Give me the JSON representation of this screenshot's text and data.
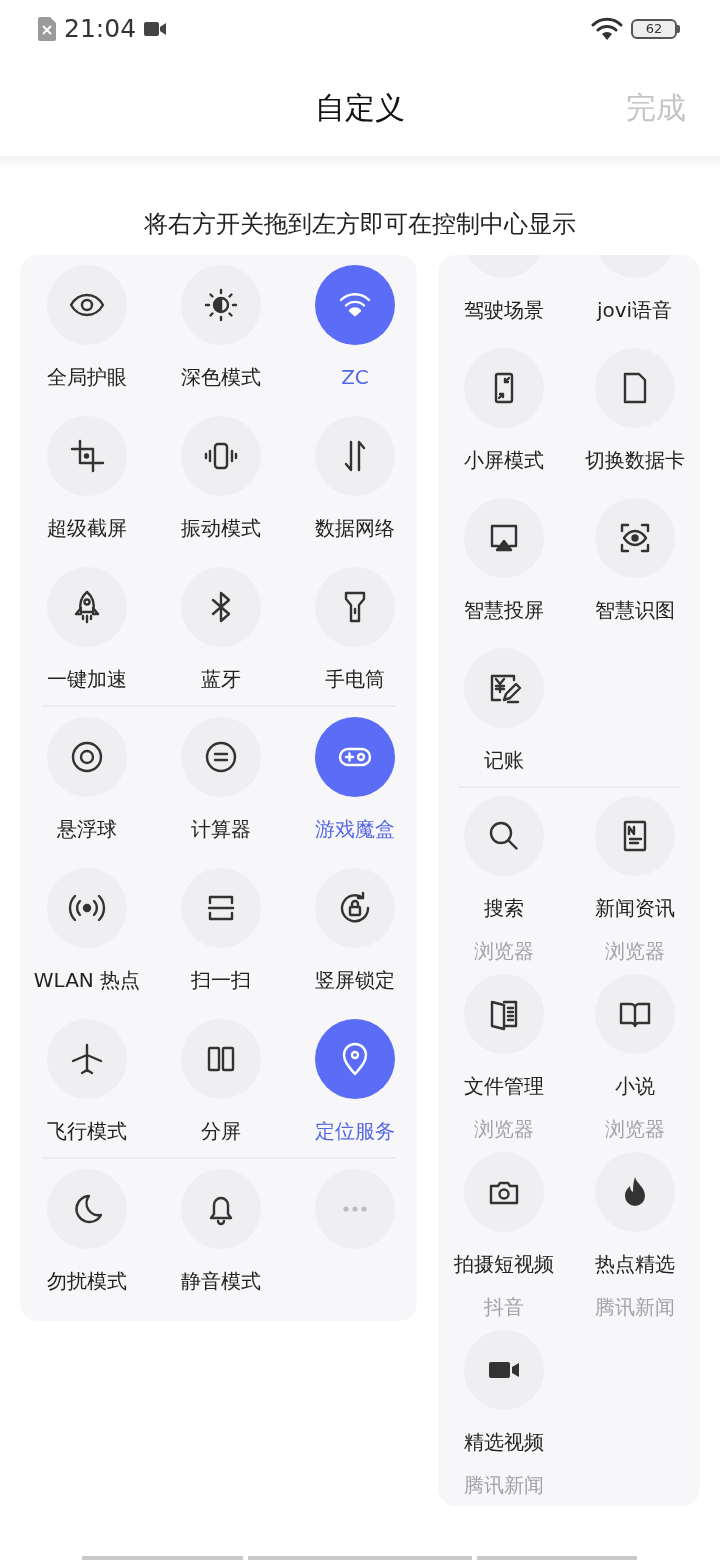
{
  "status_bar": {
    "time": "21:04",
    "battery": "62"
  },
  "header": {
    "title": "自定义",
    "done": {
      "label": "完成",
      "disabled": true
    }
  },
  "hint": "将右方开关拖到左方即可在控制中心显示",
  "active_panel": {
    "groups": [
      {
        "tiles": [
          {
            "kind": "toggle",
            "label": "全局护眼",
            "on": false
          },
          {
            "kind": "toggle",
            "label": "深色模式",
            "on": false
          },
          {
            "kind": "toggle",
            "label": "ZC",
            "on": true
          },
          {
            "kind": "toggle",
            "label": "超级截屏",
            "on": false
          },
          {
            "kind": "toggle",
            "label": "振动模式",
            "on": false
          },
          {
            "kind": "toggle",
            "label": "数据网络",
            "on": false
          },
          {
            "kind": "toggle",
            "label": "一键加速",
            "on": false
          },
          {
            "kind": "toggle",
            "label": "蓝牙",
            "on": false
          },
          {
            "kind": "toggle",
            "label": "手电筒",
            "on": false
          }
        ]
      },
      {
        "tiles": [
          {
            "kind": "toggle",
            "label": "悬浮球",
            "on": false
          },
          {
            "kind": "toggle",
            "label": "计算器",
            "on": false
          },
          {
            "kind": "toggle",
            "label": "游戏魔盒",
            "on": true
          },
          {
            "kind": "toggle",
            "label": "WLAN 热点",
            "on": false
          },
          {
            "kind": "toggle",
            "label": "扫一扫",
            "on": false
          },
          {
            "kind": "toggle",
            "label": "竖屏锁定",
            "on": false
          },
          {
            "kind": "toggle",
            "label": "飞行模式",
            "on": false
          },
          {
            "kind": "toggle",
            "label": "分屏",
            "on": false
          },
          {
            "kind": "toggle",
            "label": "定位服务",
            "on": true
          }
        ]
      },
      {
        "tiles": [
          {
            "kind": "toggle",
            "label": "勿扰模式",
            "on": false
          },
          {
            "kind": "toggle",
            "label": "静音模式",
            "on": false
          },
          {
            "kind": "more"
          }
        ]
      }
    ]
  },
  "available_panel": {
    "groups": [
      {
        "tiles": [
          {
            "label": "驾驶场景"
          },
          {
            "label": "jovi语音"
          },
          {
            "label": "小屏模式"
          },
          {
            "label": "切换数据卡"
          },
          {
            "label": "智慧投屏"
          },
          {
            "label": "智慧识图"
          },
          {
            "label": "记账"
          }
        ]
      },
      {
        "tiles": [
          {
            "label": "搜索",
            "source": "浏览器"
          },
          {
            "label": "新闻资讯",
            "source": "浏览器"
          },
          {
            "label": "文件管理",
            "source": "浏览器"
          },
          {
            "label": "小说",
            "source": "浏览器"
          },
          {
            "label": "拍摄短视频",
            "source": "抖音"
          },
          {
            "label": "热点精选",
            "source": "腾讯新闻"
          },
          {
            "label": "精选视频",
            "source": "腾讯新闻"
          }
        ]
      }
    ]
  }
}
